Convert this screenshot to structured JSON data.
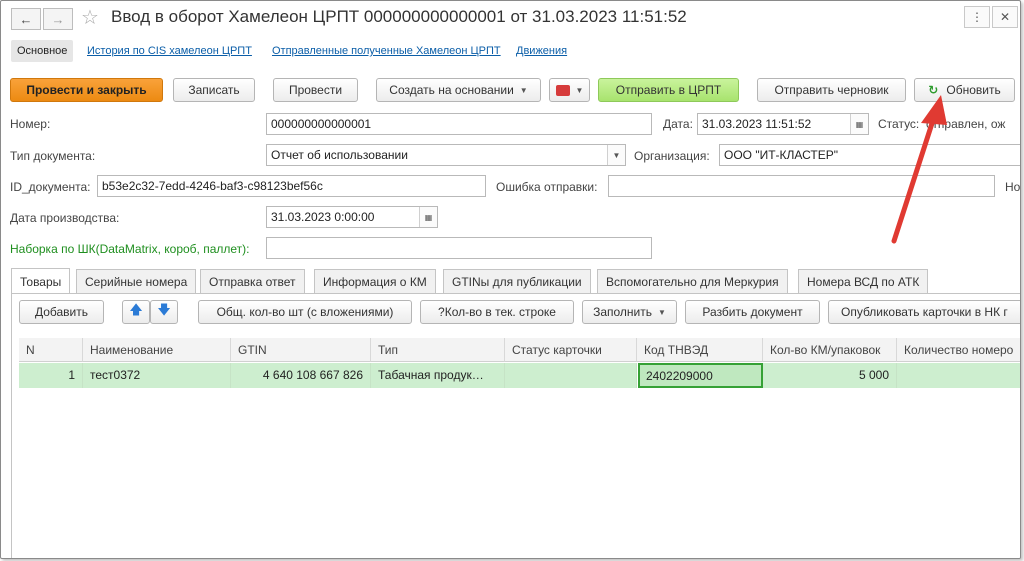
{
  "window": {
    "title": "Ввод в оборот Хамелеон ЦРПТ 000000000000001 от 31.03.2023 11:51:52",
    "back_icon": "arrow-left-icon",
    "forward_icon": "arrow-right-icon",
    "favorite_icon": "star-icon"
  },
  "section_links": [
    {
      "label": "Основное",
      "active": true
    },
    {
      "label": "История по CIS хамелеон ЦРПТ"
    },
    {
      "label": "Отправленные полученные Хамелеон ЦРПТ"
    },
    {
      "label": "Движения"
    }
  ],
  "toolbar": {
    "post_close": "Провести и закрыть",
    "save": "Записать",
    "post": "Провести",
    "create_based": "Создать на основании",
    "send_crpt": "Отправить в ЦРПТ",
    "send_draft": "Отправить черновик",
    "refresh": "Обновить"
  },
  "form": {
    "number_label": "Номер:",
    "number_value": "000000000000001",
    "date_label": "Дата:",
    "date_value": "31.03.2023 11:51:52",
    "status_label": "Статус:",
    "status_value": "отправлен, ож",
    "doc_type_label": "Тип документа:",
    "doc_type_value": "Отчет об использовании",
    "org_label": "Организация:",
    "org_value": "ООО \"ИТ-КЛАСТЕР\"",
    "doc_id_label": "ID_документа:",
    "doc_id_value": "b53e2c32-7edd-4246-baf3-c98123bef56c",
    "send_error_label": "Ошибка отправки:",
    "send_error_value": "",
    "no_label": "Но",
    "prod_date_label": "Дата производства:",
    "prod_date_value": "31.03.2023  0:00:00",
    "barcode_label": "Наборка по ШК(DataMatrix, короб, паллет):",
    "barcode_value": ""
  },
  "tabs": [
    {
      "label": "Товары",
      "active": true
    },
    {
      "label": "Серийные номера"
    },
    {
      "label": "Отправка ответ"
    },
    {
      "label": "Информация о КМ"
    },
    {
      "label": "GTINы для публикации"
    },
    {
      "label": "Вспомогательно для Меркурия"
    },
    {
      "label": "Номера ВСД по АТК"
    }
  ],
  "table_toolbar": {
    "add": "Добавить",
    "total_qty": "Общ. кол-во шт (с вложениями)",
    "qty_row": "?Кол-во в тек. строке",
    "fill": "Заполнить",
    "split": "Разбить документ",
    "publish": "Опубликовать карточки в НК г"
  },
  "table": {
    "columns": [
      "N",
      "Наименование",
      "GTIN",
      "Тип",
      "Статус карточки",
      "Код ТНВЭД",
      "Кол-во КМ/упаковок",
      "Количество номеро"
    ],
    "rows": [
      [
        "1",
        "тест0372",
        "4 640 108 667 826",
        "Табачная продук…",
        "",
        "2402209000",
        "5 000",
        ""
      ]
    ]
  },
  "colors": {
    "primary_button": "#ef8c17",
    "send_button": "#b4e87f",
    "selected_row": "#cdeecf",
    "arrow": "#e03a32",
    "link": "#0b5ea8"
  }
}
